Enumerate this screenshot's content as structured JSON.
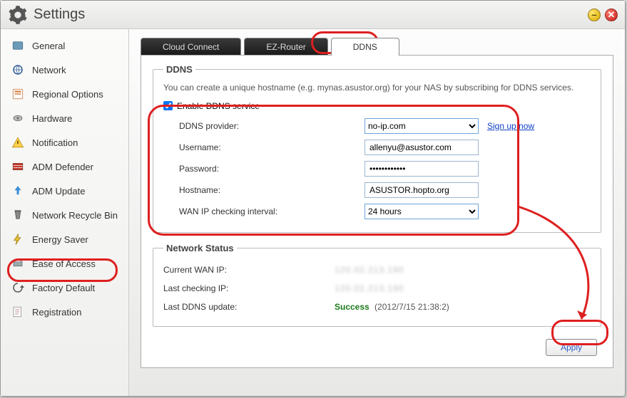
{
  "window": {
    "title": "Settings"
  },
  "sidebar": {
    "items": [
      {
        "label": "General"
      },
      {
        "label": "Network"
      },
      {
        "label": "Regional Options"
      },
      {
        "label": "Hardware"
      },
      {
        "label": "Notification"
      },
      {
        "label": "ADM Defender"
      },
      {
        "label": "ADM Update"
      },
      {
        "label": "Network Recycle Bin"
      },
      {
        "label": "Energy Saver"
      },
      {
        "label": "Ease of Access"
      },
      {
        "label": "Factory Default"
      },
      {
        "label": "Registration"
      }
    ]
  },
  "tabs": {
    "cloud": "Cloud Connect",
    "ez": "EZ-Router",
    "ddns": "DDNS"
  },
  "ddns": {
    "legend": "DDNS",
    "desc": "You can create a unique hostname (e.g. mynas.asustor.org) for your NAS by subscribing for DDNS services.",
    "enable_label": "Enable DDNS service",
    "enable_checked": true,
    "provider_label": "DDNS provider:",
    "provider_value": "no-ip.com",
    "signup": "Sign up now",
    "username_label": "Username:",
    "username_value": "allenyu@asustor.com",
    "password_label": "Password:",
    "password_value": "••••••••••••",
    "hostname_label": "Hostname:",
    "hostname_value": "ASUSTOR.hopto.org",
    "interval_label": "WAN IP checking interval:",
    "interval_value": "24 hours"
  },
  "status": {
    "legend": "Network Status",
    "wan_label": "Current WAN IP:",
    "wan_value": "120.02.213.190",
    "lastip_label": "Last checking IP:",
    "lastip_value": "120.02.213.190",
    "lastddns_label": "Last DDNS update:",
    "lastddns_status": "Success",
    "lastddns_date": "(2012/7/15 21:38:2)"
  },
  "buttons": {
    "apply": "Apply"
  }
}
